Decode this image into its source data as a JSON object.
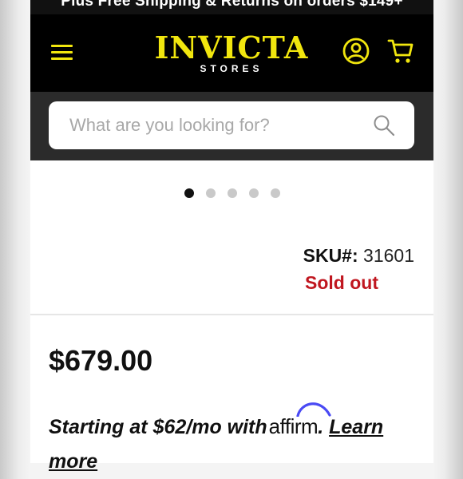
{
  "promo": {
    "text": "Plus Free Shipping & Returns on orders $149+"
  },
  "header": {
    "logo_text": "INVICTA",
    "logo_subtext": "STORES",
    "brand_color": "#f1e60e",
    "icons": [
      "hamburger-menu-icon",
      "account-icon",
      "cart-icon"
    ]
  },
  "search": {
    "placeholder": "What are you looking for?",
    "value": "",
    "icon": "search-icon"
  },
  "carousel": {
    "slide_count": 5,
    "active_index": 0
  },
  "product": {
    "sku_label": "SKU#:",
    "sku_value": "31601",
    "stock_status": "Sold out",
    "stock_color": "#c0161f",
    "price": "$679.00"
  },
  "financing": {
    "text_before": "Starting at $62/mo with",
    "provider_logo": "affirm",
    "period": ".",
    "link_text": "Learn more"
  }
}
